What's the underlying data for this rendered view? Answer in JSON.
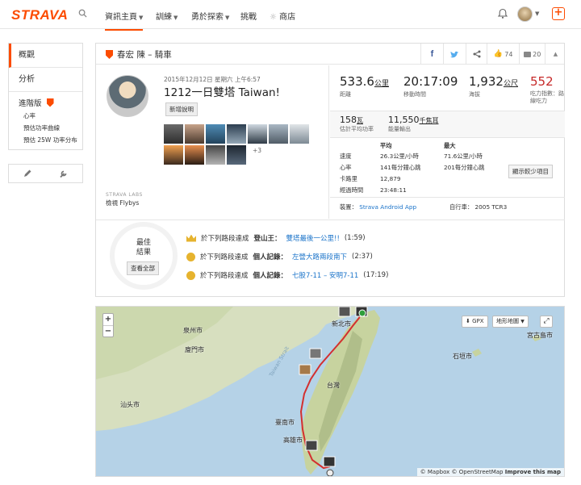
{
  "nav": {
    "logo": "STRAVA",
    "items": [
      "資訊主頁",
      "訓練",
      "勇於探索",
      "挑戰",
      "商店"
    ]
  },
  "sidebar": {
    "items": [
      "概觀",
      "分析"
    ],
    "premium_title": "進階版",
    "premium_items": [
      "心率",
      "預估功率曲線",
      "預估 25W 功率分布"
    ]
  },
  "header": {
    "title": "春宏 陳 – 騎車",
    "kudos_count": "74",
    "comments_count": "20"
  },
  "activity": {
    "date": "2015年12月12日 星期六 上午6:57",
    "title": "1212一日雙塔 Taiwan!",
    "add_desc": "新增說明",
    "more_photos": "+3",
    "labs": "STRAVA LABS",
    "flybys": "檢視 Flybys"
  },
  "stats": {
    "distance": "533.6",
    "distance_unit": "公里",
    "distance_label": "距離",
    "moving_time": "20:17:09",
    "moving_time_label": "移動時間",
    "elevation": "1,932",
    "elevation_unit": "公尺",
    "elevation_label": "海拔",
    "suffer": "552",
    "suffer_label": "吃力指數：路線吃力",
    "power": "158",
    "power_unit": "瓦",
    "power_label": "估計平均功率",
    "energy": "11,550",
    "energy_unit": "千焦耳",
    "energy_label": "能量輸出"
  },
  "table": {
    "col_avg": "平均",
    "col_max": "最大",
    "rows": [
      {
        "label": "速度",
        "avg": "26.3公里/小時",
        "max": "71.6公里/小時"
      },
      {
        "label": "心率",
        "avg": "141每分鐘心跳",
        "max": "201每分鐘心跳"
      },
      {
        "label": "卡路里",
        "avg": "12,879",
        "max": ""
      },
      {
        "label": "經過時間",
        "avg": "23:48:11",
        "max": ""
      }
    ],
    "show_less": "顯示較少項目",
    "device_label": "裝置：",
    "device": "Strava Android App",
    "bike_label": "自行車：",
    "bike": "2005 TCR3"
  },
  "achievements": {
    "best_title_1": "最佳",
    "best_title_2": "結果",
    "view_all": "查看全部",
    "rows": [
      {
        "prefix": "於下列路段達成",
        "type": "登山王：",
        "segment": "雙塔最後一公里!!",
        "value": "(1:59)"
      },
      {
        "prefix": "於下列路段達成",
        "type": "個人記錄：",
        "segment": "左營大路兩段南下",
        "value": "(2:37)"
      },
      {
        "prefix": "於下列路段達成",
        "type": "個人記錄：",
        "segment": "七股7-11 – 安明7-11",
        "value": "(17:19)"
      }
    ]
  },
  "map": {
    "gpx": "GPX",
    "terrain": "地形地圖",
    "attribution": "© Mapbox © OpenStreetMap",
    "improve": "Improve this map",
    "labels": [
      "泉州市",
      "廈門市",
      "汕头市",
      "新北市",
      "台灣",
      "臺南市",
      "高雄市",
      "石垣市",
      "宮古島市",
      "Taiwan Strait"
    ]
  },
  "colors": {
    "accent": "#fc4c02",
    "link": "#1a73c9",
    "suffer": "#c62828",
    "route": "#d32f2f",
    "sea": "#b4d1e6"
  }
}
